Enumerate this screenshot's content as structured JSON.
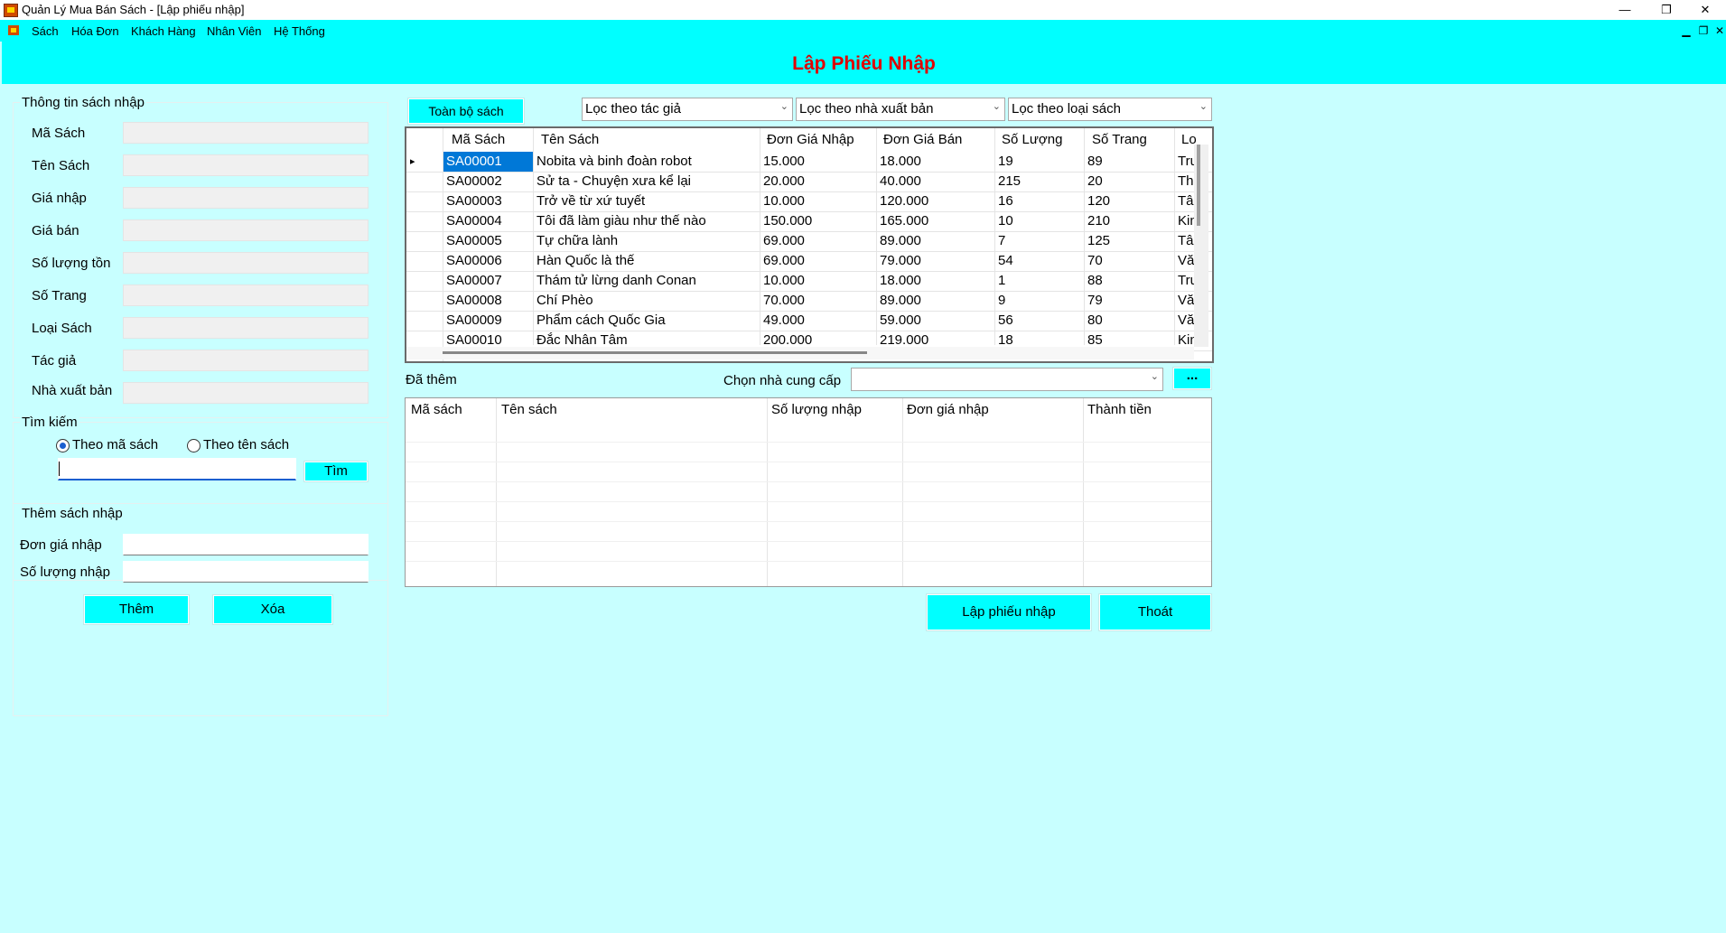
{
  "window": {
    "title": "Quản Lý Mua Bán Sách - [Lập phiếu nhập]",
    "minimize": "—",
    "maximize": "❐",
    "close": "✕"
  },
  "menu": {
    "items": [
      "Sách",
      "Hóa Đơn",
      "Khách Hàng",
      "Nhân Viên",
      "Hệ Thống"
    ],
    "mdi_minimize": "▁",
    "mdi_restore": "❐",
    "mdi_close": "✕"
  },
  "page_title": "Lập Phiếu Nhập",
  "book_info": {
    "legend": "Thông tin sách nhập",
    "fields": [
      "Mã Sách",
      "Tên Sách",
      "Giá nhập",
      "Giá bán",
      "Số lượng tồn",
      "Số Trang",
      "Loại Sách",
      "Tác giả",
      "Nhà xuất bản"
    ]
  },
  "search": {
    "legend": "Tìm kiếm",
    "option_code": "Theo mã sách",
    "option_name": "Theo tên sách",
    "selected": "Theo mã sách",
    "query": "",
    "button": "Tìm"
  },
  "add_book": {
    "legend": "Thêm sách nhập",
    "unit_price_label": "Đơn giá nhập",
    "unit_price_value": "",
    "quantity_label": "Số lượng nhập",
    "quantity_value": "",
    "add_button": "Thêm",
    "delete_button": "Xóa"
  },
  "filters": {
    "all_books_button": "Toàn bộ sách",
    "author": "Lọc theo tác giả",
    "publisher": "Lọc theo nhà xuất bản",
    "category": "Lọc theo loại sách"
  },
  "books_grid": {
    "columns": [
      "Mã Sách",
      "Tên Sách",
      "Đơn Giá Nhập",
      "Đơn Giá Bán",
      "Số Lượng",
      "Số Trang",
      "Lo"
    ],
    "rows": [
      [
        "SA00001",
        "Nobita và binh đoàn robot",
        "15.000",
        "18.000",
        "19",
        "89",
        "Tru"
      ],
      [
        "SA00002",
        "Sử ta - Chuyện xưa kể lại",
        "20.000",
        "40.000",
        "215",
        "20",
        "Thi"
      ],
      [
        "SA00003",
        "Trở về từ xứ tuyết",
        "10.000",
        "120.000",
        "16",
        "120",
        "Tâi"
      ],
      [
        "SA00004",
        "Tôi đã làm giàu như thế nào",
        "150.000",
        "165.000",
        "10",
        "210",
        "Kin"
      ],
      [
        "SA00005",
        "Tự chữa lành",
        "69.000",
        "89.000",
        "7",
        "125",
        "Tâi"
      ],
      [
        "SA00006",
        "Hàn Quốc là thế",
        "69.000",
        "79.000",
        "54",
        "70",
        "Văi"
      ],
      [
        "SA00007",
        "Thám tử lừng danh Conan",
        "10.000",
        "18.000",
        "1",
        "88",
        "Tru"
      ],
      [
        "SA00008",
        "Chí Phèo",
        "70.000",
        "89.000",
        "9",
        "79",
        "Văi"
      ],
      [
        "SA00009",
        "Phẩm cách Quốc Gia",
        "49.000",
        "59.000",
        "56",
        "80",
        "Văi"
      ],
      [
        "SA00010",
        "Đắc Nhân Tâm",
        "200.000",
        "219.000",
        "18",
        "85",
        "Kin"
      ]
    ],
    "selected_index": 0,
    "row_pointer": "▸"
  },
  "added": {
    "label": "Đã thêm",
    "supplier_label": "Chọn nhà cung cấp",
    "supplier_value": "",
    "browse_button": "...",
    "columns": [
      "Mã sách",
      "Tên sách",
      "Số lượng nhập",
      "Đơn giá nhập",
      "Thành tiền"
    ]
  },
  "actions": {
    "create": "Lập phiếu nhập",
    "exit": "Thoát"
  },
  "colors": {
    "accent": "#00ffff",
    "background": "#c8ffff",
    "title": "#e00000",
    "selection": "#0078d7"
  }
}
